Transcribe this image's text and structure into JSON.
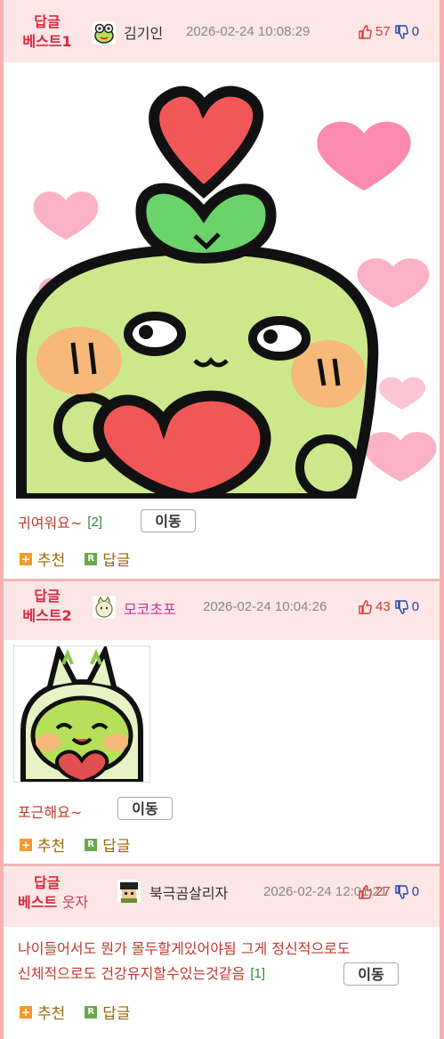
{
  "replies": [
    {
      "badge_line1": "답글",
      "badge_line2": "베스트1",
      "author": "김기인",
      "date": "2026-02-24 10:08:29",
      "up": "57",
      "down": "0",
      "comment": "귀여워요~",
      "count": "[2]",
      "move_label": "이동",
      "recommend_label": "추천",
      "reply_label": "답글"
    },
    {
      "badge_line1": "답글",
      "badge_line2": "베스트2",
      "author": "모코초포",
      "date": "2026-02-24 10:04:26",
      "up": "43",
      "down": "0",
      "comment": "포근해요~",
      "move_label": "이동",
      "recommend_label": "추천",
      "reply_label": "답글"
    },
    {
      "badge_line1": "답글",
      "badge_line2": "베스트",
      "badge_sub": "웃자",
      "author": "북극곰살리자",
      "date": "2026-02-24 12:01:21",
      "up": "27",
      "down": "0",
      "comment_line1": "나이들어서도 뭔가 몰두할게있어야됨 그게 정신적으로도",
      "comment_line2": "신체적으로도 건강유지할수있는것같음",
      "count": "[1]",
      "move_label": "이동",
      "recommend_label": "추천",
      "reply_label": "답글"
    }
  ],
  "colors": {
    "header_bg": "#fde6e6",
    "badge": "#d8283e",
    "comment": "#c0392b",
    "up": "#d53a3a",
    "down": "#2243a8",
    "frame": "#f7b1b1"
  }
}
